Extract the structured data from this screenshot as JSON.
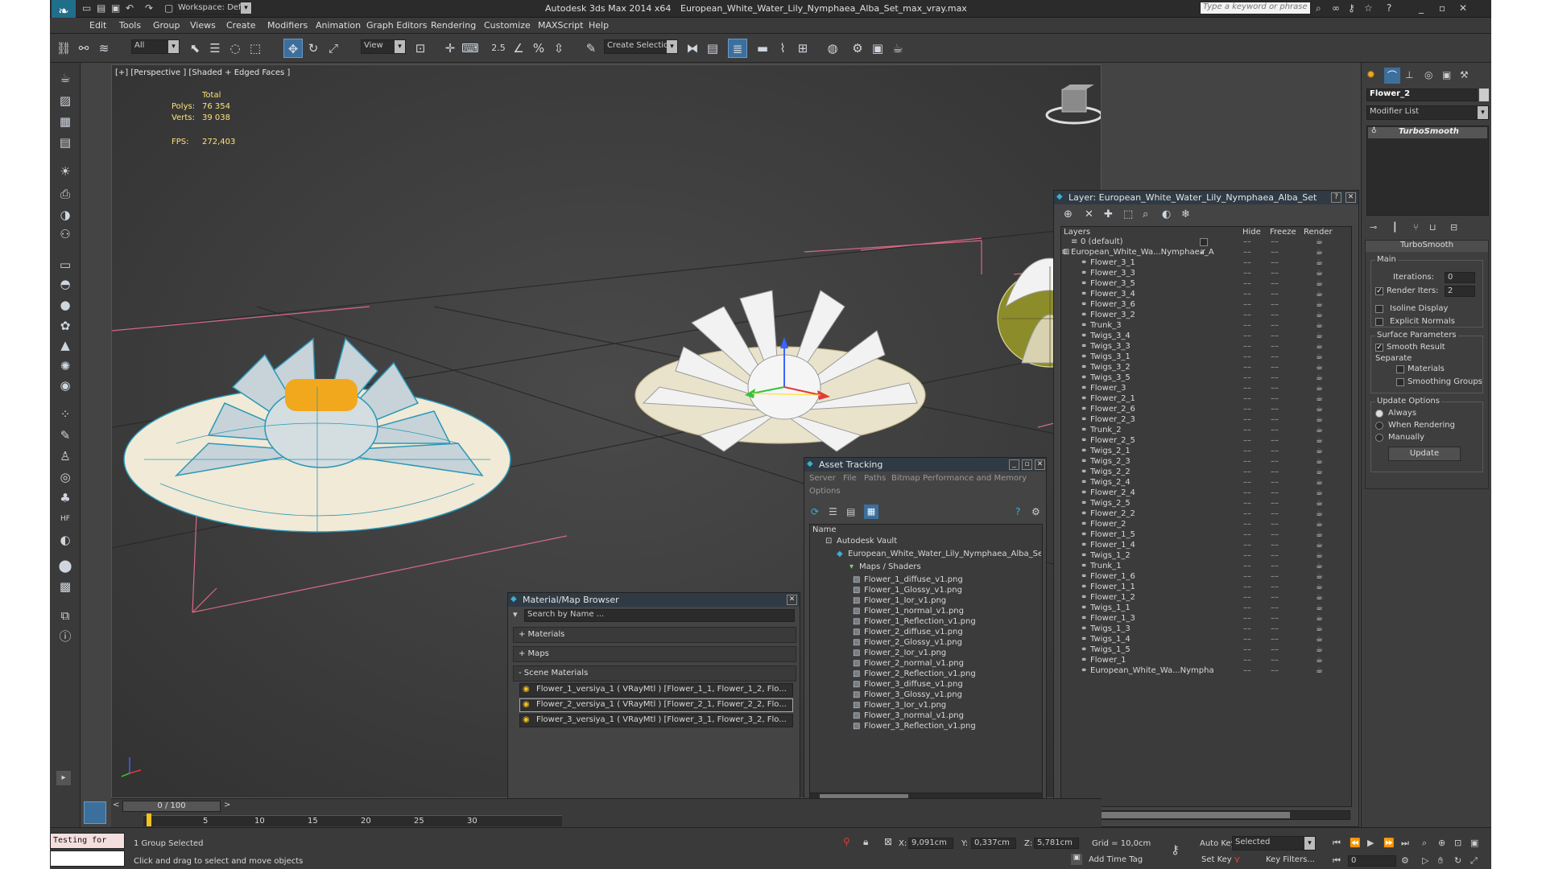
{
  "title": {
    "app": "Autodesk 3ds Max  2014 x64",
    "file": "European_White_Water_Lily_Nymphaea_Alba_Set_max_vray.max",
    "workspace": "Workspace: Default",
    "search_placeholder": "Type a keyword or phrase"
  },
  "menu": [
    "Edit",
    "Tools",
    "Group",
    "Views",
    "Create",
    "Modifiers",
    "Animation",
    "Graph Editors",
    "Rendering",
    "Customize",
    "MAXScript",
    "Help"
  ],
  "toolbar": {
    "filter": "All",
    "refcoord": "View",
    "snap_value": "2.5",
    "selection_set": "Create Selection Se"
  },
  "viewport": {
    "label": "[+] [Perspective ] [Shaded + Edged Faces ]",
    "stats_header": "Total",
    "polys_label": "Polys:",
    "polys_value": "76 354",
    "verts_label": "Verts:",
    "verts_value": "39 038",
    "fps_label": "FPS:",
    "fps_value": "272,403"
  },
  "command_panel": {
    "object_name": "Flower_2",
    "modifier_list": "Modifier List",
    "stack_item": "TurboSmooth",
    "rollout_title": "TurboSmooth",
    "main_group": "Main",
    "iterations_label": "Iterations:",
    "iterations_value": "0",
    "render_iters_label": "Render Iters:",
    "render_iters_value": "2",
    "isoline_label": "Isoline Display",
    "explicit_normals_label": "Explicit Normals",
    "surface_params_group": "Surface Parameters",
    "smooth_result_label": "Smooth Result",
    "separate_label": "Separate",
    "materials_label": "Materials",
    "smoothing_groups_label": "Smoothing Groups",
    "update_options_group": "Update Options",
    "always_label": "Always",
    "when_rendering_label": "When Rendering",
    "manually_label": "Manually",
    "update_button": "Update"
  },
  "layer_panel": {
    "title": "Layer: European_White_Water_Lily_Nymphaea_Alba_Set",
    "col_layers": "Layers",
    "col_hide": "Hide",
    "col_freeze": "Freeze",
    "col_render": "Render",
    "rows": [
      "0 (default)",
      "European_White_Wa...Nymphaea_Alt",
      "Flower_3_1",
      "Flower_3_3",
      "Flower_3_5",
      "Flower_3_4",
      "Flower_3_6",
      "Flower_3_2",
      "Trunk_3",
      "Twigs_3_4",
      "Twigs_3_3",
      "Twigs_3_1",
      "Twigs_3_2",
      "Twigs_3_5",
      "Flower_3",
      "Flower_2_1",
      "Flower_2_6",
      "Flower_2_3",
      "Trunk_2",
      "Flower_2_5",
      "Twigs_2_1",
      "Twigs_2_3",
      "Twigs_2_2",
      "Twigs_2_4",
      "Flower_2_4",
      "Twigs_2_5",
      "Flower_2_2",
      "Flower_2",
      "Flower_1_5",
      "Flower_1_4",
      "Twigs_1_2",
      "Trunk_1",
      "Flower_1_6",
      "Flower_1_1",
      "Flower_1_2",
      "Twigs_1_1",
      "Flower_1_3",
      "Twigs_1_3",
      "Twigs_1_4",
      "Twigs_1_5",
      "Flower_1",
      "European_White_Wa...Nymphaea_"
    ]
  },
  "asset_tracking": {
    "title": "Asset Tracking",
    "menu": [
      "Server",
      "File",
      "Paths",
      "Bitmap Performance and Memory",
      "Options"
    ],
    "col_name": "Name",
    "vault": "Autodesk Vault",
    "scene_file": "European_White_Water_Lily_Nymphaea_Alba_Set_m",
    "maps_folder": "Maps / Shaders",
    "files": [
      "Flower_1_diffuse_v1.png",
      "Flower_1_Glossy_v1.png",
      "Flower_1_Ior_v1.png",
      "Flower_1_normal_v1.png",
      "Flower_1_Reflection_v1.png",
      "Flower_2_diffuse_v1.png",
      "Flower_2_Glossy_v1.png",
      "Flower_2_Ior_v1.png",
      "Flower_2_normal_v1.png",
      "Flower_2_Reflection_v1.png",
      "Flower_3_diffuse_v1.png",
      "Flower_3_Glossy_v1.png",
      "Flower_3_Ior_v1.png",
      "Flower_3_normal_v1.png",
      "Flower_3_Reflection_v1.png"
    ]
  },
  "material_browser": {
    "title": "Material/Map Browser",
    "search_placeholder": "Search by Name ...",
    "sec_materials": "+ Materials",
    "sec_maps": "+ Maps",
    "sec_scene": "- Scene Materials",
    "items": [
      "Flower_1_versiya_1  ( VRayMtl )  [Flower_1_1, Flower_1_2, Flo...",
      "Flower_2_versiya_1  ( VRayMtl )  [Flower_2_1, Flower_2_2, Flo...",
      "Flower_3_versiya_1  ( VRayMtl )  [Flower_3_1, Flower_3_2, Flo..."
    ]
  },
  "timeline": {
    "frame": "0 / 100",
    "ticks": [
      "5",
      "10",
      "15",
      "20",
      "25",
      "30"
    ]
  },
  "status": {
    "maxscript": "Testing for",
    "selection": "1 Group Selected",
    "prompt": "Click and drag to select and move objects",
    "x_label": "X:",
    "x_value": "9,091cm",
    "y_label": "Y:",
    "y_value": "0,337cm",
    "z_label": "Z:",
    "z_value": "5,781cm",
    "grid": "Grid = 10,0cm",
    "add_time_tag": "Add Time Tag",
    "auto_key": "Auto Key",
    "set_key": "Set Key",
    "key_mode": "Selected",
    "key_filters": "Key Filters...",
    "current_frame": "0"
  }
}
